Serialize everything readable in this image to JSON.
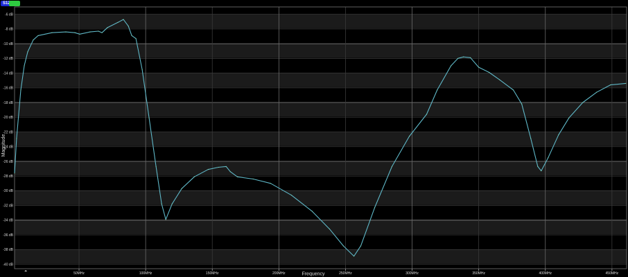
{
  "header": {
    "trace_label": "S12",
    "trace_color": "#1a2bd8",
    "state_color": "#2ecc40"
  },
  "chart_data": {
    "type": "line",
    "title": "",
    "xlabel": "Frequency",
    "ylabel": "Magnitude",
    "xlim": [
      1.6,
      461
    ],
    "ylim": [
      -40.6,
      -5
    ],
    "grid": true,
    "x_ticks": [
      50,
      100,
      150,
      200,
      250,
      300,
      350,
      400,
      450
    ],
    "x_tick_labels": [
      "50MHz",
      "100MHz",
      "150MHz",
      "200MHz",
      "250MHz",
      "300MHz",
      "350MHz",
      "400MHz",
      "450MHz"
    ],
    "y_ticks": [
      -6,
      -8,
      -10,
      -12,
      -14,
      -16,
      -18,
      -20,
      -22,
      -24,
      -26,
      -28,
      -30,
      -32,
      -34,
      -36,
      -38,
      -40
    ],
    "y_tick_labels": [
      "-6 dB",
      "-8 dB",
      "-10 dB",
      "-12 dB",
      "-14 dB",
      "-16 dB",
      "-18 dB",
      "-20 dB",
      "-22 dB",
      "-24 dB",
      "-26 dB",
      "-28 dB",
      "-30 dB",
      "-32 dB",
      "-34 dB",
      "-36 dB",
      "-38 dB",
      "-40 dB"
    ],
    "series": [
      {
        "name": "S12",
        "color": "#5fb8c8",
        "x": [
          1.6,
          3.1,
          6.3,
          8.9,
          11.5,
          15.6,
          19.3,
          29.7,
          40.1,
          46.9,
          50.5,
          58.3,
          64.6,
          67.2,
          71.4,
          79.2,
          83.3,
          87.0,
          89.6,
          92.7,
          97.4,
          102.6,
          107.8,
          112.0,
          115.1,
          119.8,
          127.1,
          136.5,
          146.9,
          154.7,
          160.4,
          163.5,
          168.8,
          180.7,
          193.8,
          209.4,
          225.0,
          238.0,
          248.4,
          256.3,
          261.5,
          271.9,
          284.9,
          297.9,
          310.9,
          318.8,
          329.2,
          334.4,
          338.5,
          343.8,
          350.0,
          357.8,
          365.6,
          376.0,
          382.3,
          389.1,
          394.3,
          396.9,
          402.1,
          409.9,
          417.7,
          428.1,
          438.5,
          448.9,
          460.4
        ],
        "y": [
          -27.6,
          -22.9,
          -16.3,
          -13.0,
          -11.1,
          -9.5,
          -8.9,
          -8.5,
          -8.4,
          -8.5,
          -8.7,
          -8.4,
          -8.3,
          -8.5,
          -7.8,
          -7.1,
          -6.7,
          -7.6,
          -8.9,
          -9.3,
          -13.5,
          -20.1,
          -26.7,
          -31.8,
          -33.9,
          -31.8,
          -29.7,
          -28.1,
          -27.1,
          -26.8,
          -26.7,
          -27.4,
          -28.1,
          -28.4,
          -29.0,
          -30.6,
          -32.8,
          -35.2,
          -37.5,
          -38.9,
          -37.5,
          -32.3,
          -26.7,
          -22.6,
          -19.6,
          -16.3,
          -13.0,
          -12.0,
          -11.8,
          -11.9,
          -13.2,
          -13.9,
          -14.9,
          -16.3,
          -18.2,
          -22.9,
          -26.7,
          -27.3,
          -25.5,
          -22.4,
          -20.1,
          -18.0,
          -16.6,
          -15.6,
          -15.4
        ]
      }
    ]
  }
}
